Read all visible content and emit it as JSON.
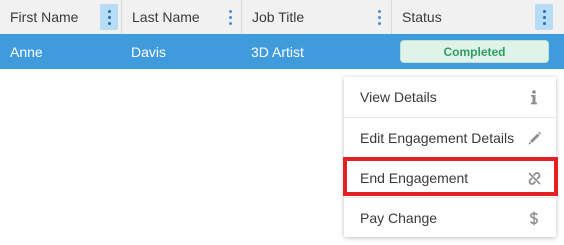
{
  "table": {
    "columns": [
      {
        "label": "First Name"
      },
      {
        "label": "Last Name"
      },
      {
        "label": "Job Title"
      },
      {
        "label": "Status"
      }
    ],
    "row": {
      "first_name": "Anne",
      "last_name": "Davis",
      "job_title": "3D Artist",
      "status": "Completed"
    }
  },
  "context_menu": {
    "items": [
      {
        "label": "View Details",
        "icon": "info-icon"
      },
      {
        "label": "Edit Engagement Details",
        "icon": "pencil-icon"
      },
      {
        "label": "End Engagement",
        "icon": "broken-link-icon"
      },
      {
        "label": "Pay Change",
        "icon": "dollar-icon"
      }
    ]
  },
  "colors": {
    "selected_row": "#3f9bdc",
    "status_badge_text": "#2f9e63",
    "highlight_box": "#e32024"
  }
}
